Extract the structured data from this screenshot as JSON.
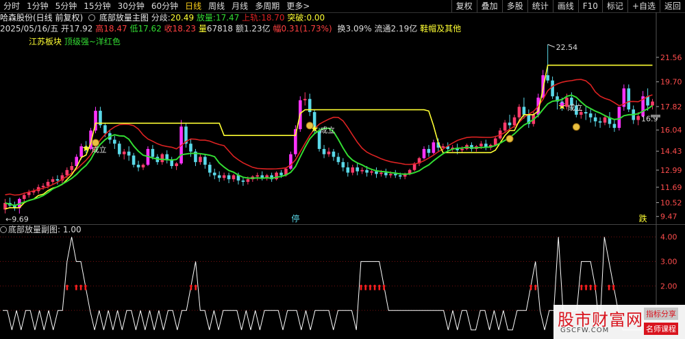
{
  "toolbar": {
    "tabs": [
      "分时",
      "1分钟",
      "5分钟",
      "15分钟",
      "30分钟",
      "60分钟",
      "日线",
      "周线",
      "月线",
      "多周期",
      "更多>"
    ],
    "active": "日线",
    "right_buttons": [
      "复权",
      "叠加",
      "多股",
      "统计",
      "画线",
      "F10",
      "标记",
      "+自选",
      "返回"
    ]
  },
  "info1": {
    "stock": "哈森股份(日线 前复权)",
    "indicator": "底部放量主图",
    "fenqi_label": "分歧:",
    "fenqi": "20.49",
    "fangliang_label": "放量:",
    "fangliang": "17.47",
    "shangui_label": "上轨:",
    "shangui": "18.70",
    "tupo_label": "突破:",
    "tupo": "0.00"
  },
  "info2": {
    "date": "2025/05/16/五",
    "open_l": "开",
    "open": "17.92",
    "high_l": "高",
    "high": "18.47",
    "low_l": "低",
    "low": "17.62",
    "close_l": "收",
    "close": "18.23",
    "vol_l": "量",
    "vol": "67818",
    "amt_l": "额",
    "amt": "1.23亿",
    "chg_l": "幅",
    "chg": "0.31(1.73%)",
    "turn_l": "换",
    "turn": "3.09%",
    "float_l": "流通",
    "float": "2.19亿",
    "sector": "鞋帽及其他"
  },
  "block": {
    "name": "江苏板块",
    "desc": "顶级强~洋红色"
  },
  "sub": {
    "title": "底部放量副图",
    "value": ": 1.00"
  },
  "watermark": {
    "main": "股市财富网",
    "url": "GSCFW.COM",
    "badge1": "指标分享",
    "badge2": "名师课程"
  },
  "colors": {
    "up": "#ff3b6b",
    "down": "#5ad8e8",
    "magenta": "#ff33ff",
    "yellow": "#ffff33",
    "green": "#33dd33",
    "red": "#dd2222",
    "sub_line": "#ffffff",
    "arrow": "#ff2020"
  },
  "chart_data": {
    "type": "candlestick",
    "price_axis": [
      "21.56",
      "19.70",
      "17.82",
      "16.04",
      "14.43",
      "12.99",
      "11.69",
      "10.52",
      "9.47"
    ],
    "sub_axis": [
      "4.00",
      "3.00",
      "2.00",
      "1.00"
    ],
    "ylim": [
      9.3,
      22.8
    ],
    "annotations": {
      "high": "22.54",
      "low": "9.69",
      "last": "16.9",
      "signal": "成立",
      "ting": "停",
      "die": "跌"
    },
    "candles": [
      [
        10.0,
        10.8,
        10.5,
        9.7
      ],
      [
        10.5,
        10.9,
        10.3,
        10.1
      ],
      [
        10.3,
        10.6,
        10.1,
        9.9
      ],
      [
        10.1,
        10.9,
        10.8,
        9.69
      ],
      [
        10.8,
        11.3,
        11.1,
        10.6
      ],
      [
        11.1,
        11.5,
        11.3,
        10.9
      ],
      [
        11.3,
        11.6,
        11.4,
        11.1
      ],
      [
        11.4,
        11.9,
        11.7,
        11.2
      ],
      [
        11.7,
        12.0,
        11.8,
        11.5
      ],
      [
        11.8,
        12.3,
        12.1,
        11.6
      ],
      [
        12.1,
        12.5,
        12.3,
        11.9
      ],
      [
        12.3,
        12.6,
        12.2,
        11.9
      ],
      [
        12.2,
        12.8,
        12.6,
        12.0
      ],
      [
        12.6,
        13.2,
        13.0,
        12.4
      ],
      [
        13.0,
        13.6,
        13.3,
        12.8
      ],
      [
        13.3,
        14.2,
        14.0,
        13.1
      ],
      [
        14.0,
        15.0,
        14.8,
        13.8
      ],
      [
        14.8,
        15.2,
        14.6,
        14.3
      ],
      [
        14.6,
        16.2,
        16.0,
        14.5
      ],
      [
        16.0,
        17.8,
        17.5,
        15.8
      ],
      [
        17.5,
        17.8,
        16.4,
        16.2
      ],
      [
        16.4,
        16.6,
        15.8,
        15.5
      ],
      [
        15.8,
        16.0,
        15.3,
        15.0
      ],
      [
        15.3,
        15.6,
        15.0,
        14.6
      ],
      [
        15.0,
        15.2,
        14.2,
        14.0
      ],
      [
        14.2,
        14.6,
        14.4,
        13.8
      ],
      [
        14.4,
        14.8,
        14.1,
        13.7
      ],
      [
        14.1,
        14.3,
        13.4,
        13.2
      ],
      [
        13.4,
        13.7,
        13.2,
        12.9
      ],
      [
        13.2,
        13.5,
        13.4,
        13.0
      ],
      [
        13.4,
        14.8,
        14.6,
        13.3
      ],
      [
        14.6,
        14.9,
        14.0,
        13.8
      ],
      [
        14.0,
        14.2,
        13.6,
        13.4
      ],
      [
        13.6,
        14.3,
        14.2,
        13.4
      ],
      [
        14.2,
        14.5,
        13.8,
        13.5
      ],
      [
        13.8,
        14.0,
        13.3,
        13.1
      ],
      [
        13.3,
        13.6,
        13.5,
        13.0
      ],
      [
        13.5,
        16.8,
        16.3,
        13.4
      ],
      [
        16.3,
        16.6,
        15.0,
        14.7
      ],
      [
        15.0,
        15.4,
        14.4,
        14.0
      ],
      [
        14.4,
        14.6,
        13.6,
        13.3
      ],
      [
        13.6,
        14.2,
        14.0,
        13.4
      ],
      [
        14.0,
        14.2,
        13.4,
        13.1
      ],
      [
        13.4,
        13.6,
        12.8,
        12.5
      ],
      [
        12.8,
        13.1,
        12.6,
        12.3
      ],
      [
        12.6,
        12.9,
        12.4,
        12.1
      ],
      [
        12.4,
        12.8,
        12.6,
        12.2
      ],
      [
        12.6,
        12.8,
        12.3,
        12.0
      ],
      [
        12.3,
        12.7,
        12.6,
        12.1
      ],
      [
        12.6,
        12.8,
        12.2,
        11.9
      ],
      [
        12.2,
        12.4,
        12.1,
        11.8
      ],
      [
        12.1,
        12.5,
        12.3,
        11.9
      ],
      [
        12.3,
        12.6,
        12.5,
        12.1
      ],
      [
        12.5,
        12.8,
        12.6,
        12.2
      ],
      [
        12.6,
        12.9,
        12.4,
        12.2
      ],
      [
        12.4,
        12.7,
        12.6,
        12.2
      ],
      [
        12.6,
        12.8,
        12.3,
        12.1
      ],
      [
        12.3,
        12.9,
        12.8,
        12.2
      ],
      [
        12.8,
        13.0,
        12.6,
        12.4
      ],
      [
        12.6,
        13.2,
        13.1,
        12.5
      ],
      [
        13.1,
        14.4,
        14.2,
        13.0
      ],
      [
        14.2,
        16.4,
        16.1,
        14.0
      ],
      [
        16.1,
        18.6,
        18.3,
        15.9
      ],
      [
        18.3,
        18.9,
        18.4,
        17.9
      ],
      [
        18.4,
        18.8,
        17.4,
        17.1
      ],
      [
        17.4,
        17.6,
        16.0,
        15.8
      ],
      [
        16.0,
        16.2,
        14.6,
        14.4
      ],
      [
        14.6,
        14.9,
        14.2,
        13.9
      ],
      [
        14.2,
        14.7,
        14.4,
        14.0
      ],
      [
        14.4,
        14.6,
        14.0,
        13.7
      ],
      [
        14.0,
        14.3,
        13.6,
        13.4
      ],
      [
        13.6,
        13.9,
        13.2,
        12.9
      ],
      [
        13.2,
        13.6,
        12.8,
        12.5
      ],
      [
        12.8,
        13.4,
        13.2,
        12.6
      ],
      [
        13.2,
        13.5,
        12.9,
        12.6
      ],
      [
        12.9,
        13.2,
        13.0,
        12.7
      ],
      [
        13.0,
        13.3,
        12.8,
        12.5
      ],
      [
        12.8,
        13.1,
        12.9,
        12.6
      ],
      [
        12.9,
        13.2,
        12.7,
        12.4
      ],
      [
        12.7,
        13.0,
        12.8,
        12.5
      ],
      [
        12.8,
        13.1,
        12.6,
        12.4
      ],
      [
        12.6,
        12.9,
        12.7,
        12.4
      ],
      [
        12.7,
        13.0,
        12.6,
        12.4
      ],
      [
        12.6,
        12.8,
        12.5,
        12.3
      ],
      [
        12.5,
        12.8,
        12.7,
        12.3
      ],
      [
        12.7,
        13.1,
        13.0,
        12.6
      ],
      [
        13.0,
        13.6,
        13.5,
        12.9
      ],
      [
        13.5,
        14.0,
        13.9,
        13.3
      ],
      [
        13.9,
        14.8,
        14.6,
        13.8
      ],
      [
        14.6,
        14.9,
        14.3,
        14.0
      ],
      [
        14.3,
        15.3,
        15.1,
        14.2
      ],
      [
        15.1,
        15.4,
        14.7,
        14.4
      ],
      [
        14.7,
        15.0,
        14.8,
        14.5
      ],
      [
        14.8,
        15.1,
        14.6,
        14.3
      ],
      [
        14.6,
        14.9,
        14.7,
        14.4
      ],
      [
        14.7,
        15.0,
        14.5,
        14.2
      ],
      [
        14.5,
        14.8,
        14.6,
        14.3
      ],
      [
        14.6,
        15.0,
        14.9,
        14.5
      ],
      [
        14.9,
        15.1,
        14.6,
        14.4
      ],
      [
        14.6,
        14.9,
        14.8,
        14.4
      ],
      [
        14.8,
        15.2,
        15.0,
        14.6
      ],
      [
        15.0,
        15.3,
        14.7,
        14.5
      ],
      [
        14.7,
        15.0,
        14.9,
        14.5
      ],
      [
        14.9,
        15.6,
        15.4,
        14.8
      ],
      [
        15.4,
        16.2,
        16.0,
        15.3
      ],
      [
        16.0,
        16.8,
        16.6,
        15.8
      ],
      [
        16.6,
        17.2,
        16.4,
        16.1
      ],
      [
        16.4,
        17.2,
        17.0,
        16.2
      ],
      [
        17.0,
        18.0,
        17.8,
        16.8
      ],
      [
        17.8,
        18.5,
        17.2,
        16.9
      ],
      [
        17.2,
        17.6,
        16.5,
        16.2
      ],
      [
        16.5,
        17.4,
        17.2,
        16.3
      ],
      [
        17.2,
        18.8,
        18.5,
        17.0
      ],
      [
        18.5,
        20.6,
        20.2,
        18.4
      ],
      [
        20.2,
        22.54,
        19.8,
        19.6
      ],
      [
        19.8,
        20.1,
        18.6,
        18.4
      ],
      [
        18.6,
        18.9,
        18.2,
        17.6
      ],
      [
        18.2,
        18.5,
        17.8,
        17.5
      ],
      [
        17.8,
        18.8,
        18.5,
        17.6
      ],
      [
        18.5,
        18.9,
        17.9,
        17.6
      ],
      [
        17.9,
        18.3,
        17.2,
        17.0
      ],
      [
        17.2,
        17.6,
        17.4,
        16.9
      ],
      [
        17.4,
        17.8,
        17.3,
        16.8
      ],
      [
        17.3,
        17.6,
        17.0,
        16.6
      ],
      [
        17.0,
        17.3,
        16.7,
        16.3
      ],
      [
        16.7,
        17.0,
        16.6,
        16.2
      ],
      [
        16.6,
        17.2,
        17.0,
        16.4
      ],
      [
        17.0,
        17.4,
        16.5,
        16.2
      ],
      [
        16.5,
        16.8,
        16.2,
        15.9
      ],
      [
        16.2,
        16.6,
        17.8,
        16.0
      ],
      [
        17.8,
        19.5,
        19.2,
        17.5
      ],
      [
        19.2,
        19.5,
        17.6,
        17.4
      ],
      [
        17.6,
        17.9,
        16.8,
        16.5
      ],
      [
        16.8,
        17.4,
        17.1,
        16.4
      ],
      [
        17.1,
        19.0,
        18.6,
        17.0
      ],
      [
        18.6,
        19.2,
        17.9,
        17.5
      ],
      [
        17.9,
        18.4,
        18.2,
        17.6
      ]
    ],
    "sub_series": [
      1,
      1,
      0.2,
      1,
      0.2,
      1,
      1,
      0.2,
      1,
      0.2,
      1,
      0.2,
      1,
      1,
      3,
      4,
      3,
      3,
      2,
      1,
      0.2,
      1,
      0.2,
      1,
      0.2,
      1,
      0.2,
      1,
      1,
      0.2,
      1,
      0.2,
      1,
      0.2,
      1,
      0.2,
      1,
      1,
      0.2,
      1,
      1,
      2,
      3,
      1,
      1,
      0.2,
      1,
      0.2,
      1,
      1,
      1,
      1,
      0.2,
      1,
      0.2,
      1,
      0.2,
      1,
      1,
      1,
      1,
      0.2,
      1,
      1,
      1,
      0.2,
      1,
      0.2,
      1,
      1,
      1,
      1,
      0.2,
      1,
      1,
      1,
      1,
      0.2,
      3,
      3,
      3,
      3,
      3,
      2,
      1,
      1,
      1,
      1,
      1,
      1,
      1,
      1,
      1,
      1,
      1,
      1,
      1,
      0.2,
      1,
      0.2,
      1,
      1,
      0.2,
      0.2,
      1,
      1,
      0.2,
      1,
      0.2,
      1,
      0.2,
      0.2,
      1,
      1,
      1,
      2,
      3,
      1,
      0.2,
      1,
      1,
      4,
      1,
      0.2,
      1,
      1,
      3,
      3,
      3,
      2,
      0.2,
      4,
      3,
      2,
      1,
      0.2,
      0.2,
      0.2,
      0.2,
      0.2,
      1,
      1
    ]
  }
}
